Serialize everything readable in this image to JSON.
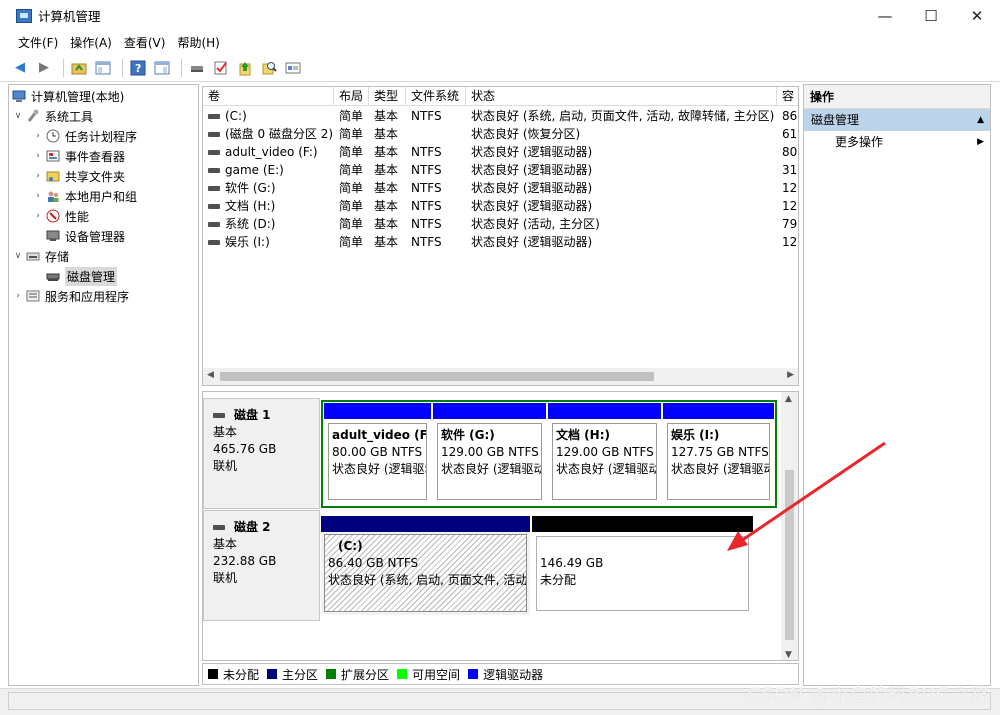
{
  "window": {
    "title": "计算机管理",
    "minimize": "—",
    "maximize": "☐",
    "close": "✕"
  },
  "menu": [
    "文件(F)",
    "操作(A)",
    "查看(V)",
    "帮助(H)"
  ],
  "tree": {
    "root": "计算机管理(本地)",
    "system_tools": "系统工具",
    "task_scheduler": "任务计划程序",
    "event_viewer": "事件查看器",
    "shared_folders": "共享文件夹",
    "local_users": "本地用户和组",
    "performance": "性能",
    "device_manager": "设备管理器",
    "storage": "存储",
    "disk_management": "磁盘管理",
    "services": "服务和应用程序"
  },
  "volumes": {
    "columns": [
      "卷",
      "布局",
      "类型",
      "文件系统",
      "状态",
      "容"
    ],
    "rows": [
      {
        "vol": "(C:)",
        "layout": "简单",
        "type": "基本",
        "fs": "NTFS",
        "status": "状态良好 (系统, 启动, 页面文件, 活动, 故障转储, 主分区)",
        "cap": "86"
      },
      {
        "vol": "(磁盘 0 磁盘分区 2)",
        "layout": "简单",
        "type": "基本",
        "fs": "",
        "status": "状态良好 (恢复分区)",
        "cap": "61"
      },
      {
        "vol": "adult_video (F:)",
        "layout": "简单",
        "type": "基本",
        "fs": "NTFS",
        "status": "状态良好 (逻辑驱动器)",
        "cap": "80"
      },
      {
        "vol": "game (E:)",
        "layout": "简单",
        "type": "基本",
        "fs": "NTFS",
        "status": "状态良好 (逻辑驱动器)",
        "cap": "31"
      },
      {
        "vol": "软件 (G:)",
        "layout": "简单",
        "type": "基本",
        "fs": "NTFS",
        "status": "状态良好 (逻辑驱动器)",
        "cap": "12"
      },
      {
        "vol": "文档 (H:)",
        "layout": "简单",
        "type": "基本",
        "fs": "NTFS",
        "status": "状态良好 (逻辑驱动器)",
        "cap": "12"
      },
      {
        "vol": "系统 (D:)",
        "layout": "简单",
        "type": "基本",
        "fs": "NTFS",
        "status": "状态良好 (活动, 主分区)",
        "cap": "79"
      },
      {
        "vol": "娱乐 (I:)",
        "layout": "简单",
        "type": "基本",
        "fs": "NTFS",
        "status": "状态良好 (逻辑驱动器)",
        "cap": "12"
      }
    ]
  },
  "disks": [
    {
      "name": "磁盘 1",
      "type": "基本",
      "size": "465.76 GB",
      "state": "联机",
      "partitions": [
        {
          "name": "adult_video  (F",
          "size": "80.00 GB NTFS",
          "status": "状态良好 (逻辑驱动器)"
        },
        {
          "name": "软件  (G:)",
          "size": "129.00 GB NTFS",
          "status": "状态良好 (逻辑驱动器)"
        },
        {
          "name": "文档  (H:)",
          "size": "129.00 GB NTFS",
          "status": "状态良好 (逻辑驱动器)"
        },
        {
          "name": "娱乐  (I:)",
          "size": "127.75 GB NTFS",
          "status": "状态良好 (逻辑驱动器)"
        }
      ]
    },
    {
      "name": "磁盘 2",
      "type": "基本",
      "size": "232.88 GB",
      "state": "联机",
      "partitions": [
        {
          "name": "(C:)",
          "size": "86.40 GB NTFS",
          "status": "状态良好 (系统, 启动, 页面文件, 活动, 故障转储, 主分区)"
        },
        {
          "name": "",
          "size": "146.49 GB",
          "status": "未分配"
        }
      ]
    }
  ],
  "legend": [
    {
      "label": "未分配",
      "color": "#000000"
    },
    {
      "label": "主分区",
      "color": "#00007f"
    },
    {
      "label": "扩展分区",
      "color": "#008000"
    },
    {
      "label": "可用空间",
      "color": "#00ff00"
    },
    {
      "label": "逻辑驱动器",
      "color": "#0000ff"
    }
  ],
  "actions": {
    "header": "操作",
    "section": "磁盘管理",
    "more": "更多操作"
  },
  "watermark": "CSDN @小白的码BUG之路",
  "colors": {
    "logical_bar": "#0000ff",
    "primary_bar": "#00007f",
    "unallocated_bar": "#000000",
    "annotation_arrow": "#e8262b"
  }
}
